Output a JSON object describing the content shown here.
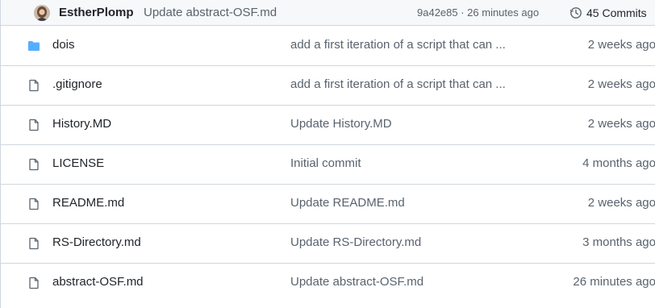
{
  "latest_commit": {
    "author": "EstherPlomp",
    "message": "Update abstract-OSF.md",
    "hash_time": "9a42e85 · 26 minutes ago",
    "commits_label": "45 Commits",
    "avatar_icon": "author-avatar",
    "history_icon": "history-clock-icon"
  },
  "colors": {
    "folder": "#54aeff",
    "muted_text": "#59636e",
    "border": "#d0d7de",
    "header_bg": "#f6f8fa"
  },
  "files": [
    {
      "name": "dois",
      "type": "folder",
      "icon": "folder-icon",
      "message": "add a first iteration of a script that can ...",
      "age": "2 weeks ago"
    },
    {
      "name": ".gitignore",
      "type": "file",
      "icon": "file-icon",
      "message": "add a first iteration of a script that can ...",
      "age": "2 weeks ago"
    },
    {
      "name": "History.MD",
      "type": "file",
      "icon": "file-icon",
      "message": "Update History.MD",
      "age": "2 weeks ago"
    },
    {
      "name": "LICENSE",
      "type": "file",
      "icon": "file-icon",
      "message": "Initial commit",
      "age": "4 months ago"
    },
    {
      "name": "README.md",
      "type": "file",
      "icon": "file-icon",
      "message": "Update README.md",
      "age": "2 weeks ago"
    },
    {
      "name": "RS-Directory.md",
      "type": "file",
      "icon": "file-icon",
      "message": "Update RS-Directory.md",
      "age": "3 months ago"
    },
    {
      "name": "abstract-OSF.md",
      "type": "file",
      "icon": "file-icon",
      "message": "Update abstract-OSF.md",
      "age": "26 minutes ago"
    }
  ]
}
